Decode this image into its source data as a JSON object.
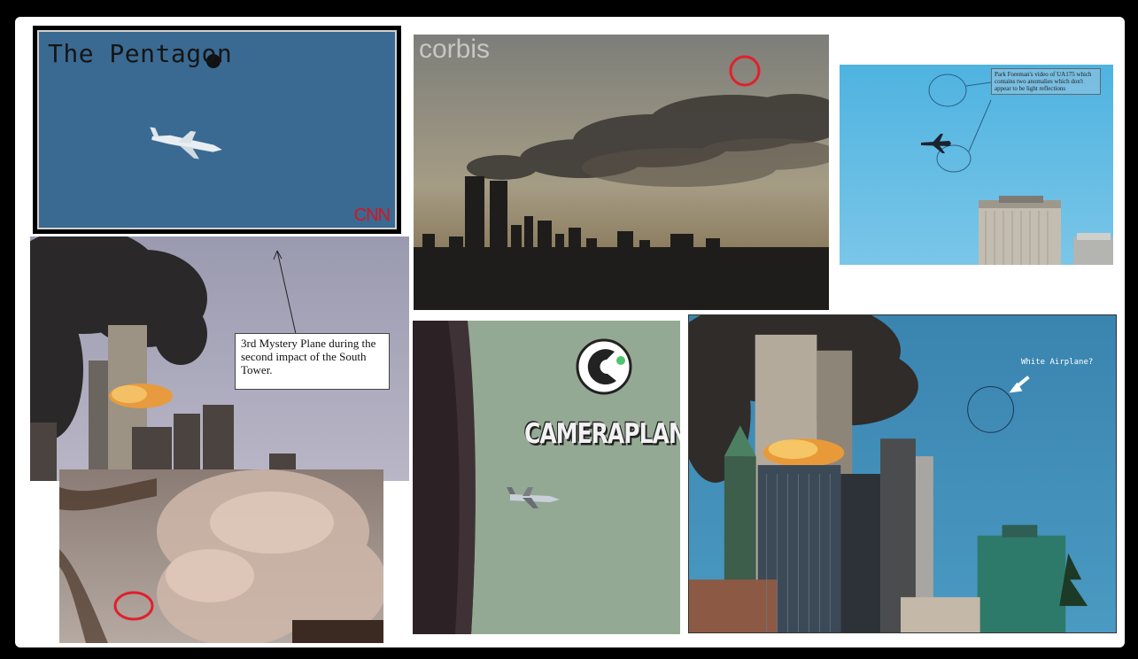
{
  "panels": {
    "pentagon": {
      "title": "The Pentagon",
      "logo": "CNN"
    },
    "corbis": {
      "watermark": "corbis"
    },
    "park_foreman": {
      "note": "Park Foreman's video of UA175 which contains two anomalies which don't appear to be light reflections"
    },
    "mystery_plane": {
      "caption": "3rd Mystery Plane during the second impact of  the South Tower."
    },
    "smoke_closeup": {},
    "cameraplanet": {
      "logo": "CAMERAPLANET"
    },
    "white_airplane": {
      "label": "White Airplane?"
    }
  },
  "colors": {
    "highlight_circle": "#e0202c",
    "background": "#000000",
    "frame": "#ffffff"
  }
}
